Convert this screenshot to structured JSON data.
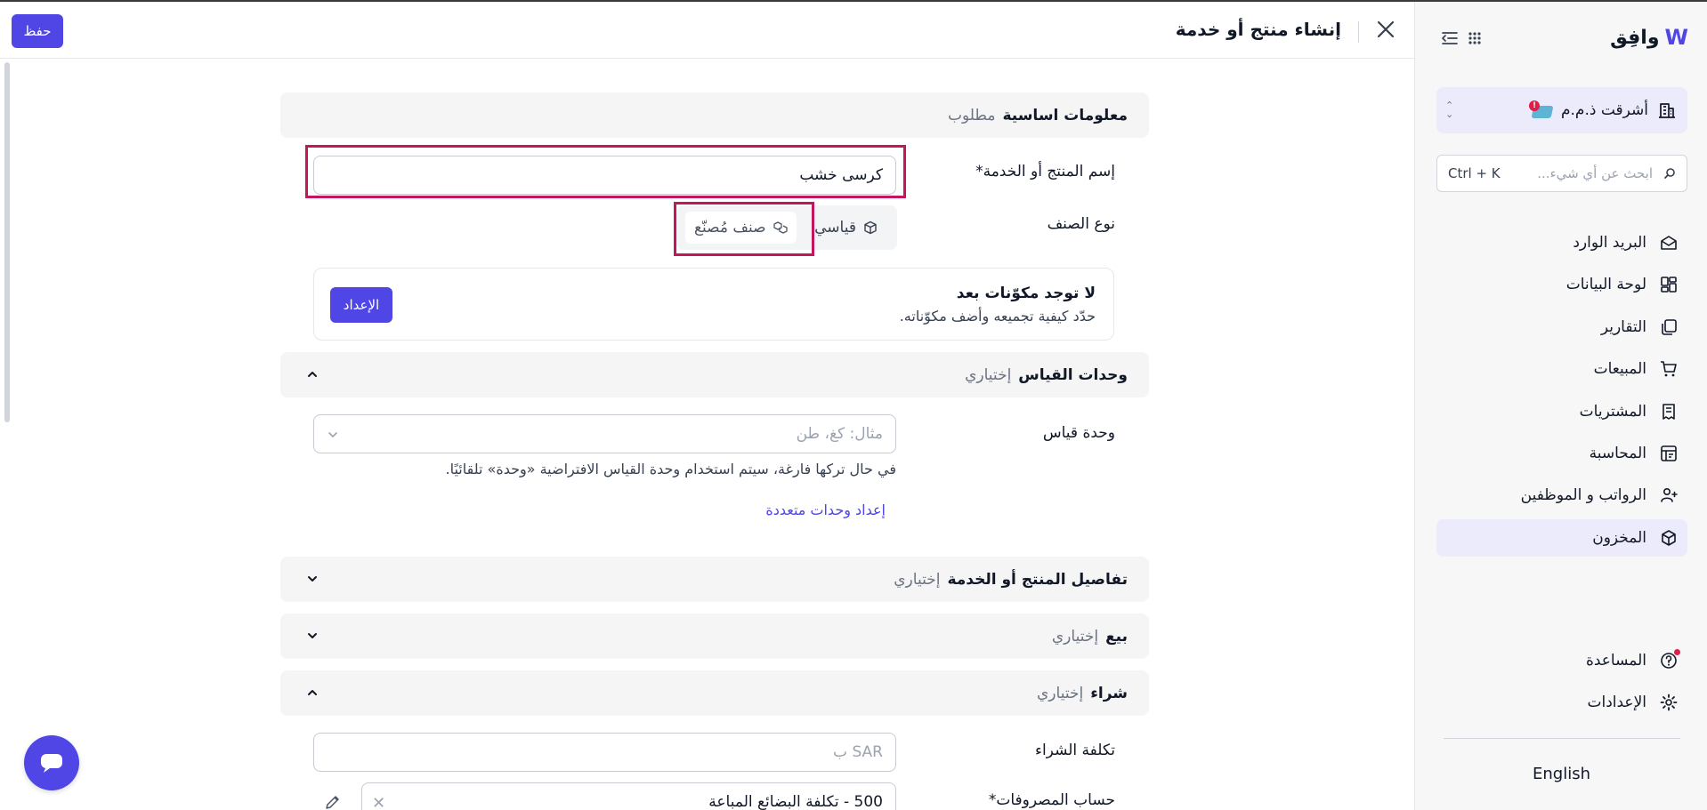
{
  "app": {
    "brand": "وافِق"
  },
  "header": {
    "title": "إنشاء منتج أو خدمة",
    "save_label": "حفظ"
  },
  "sidebar": {
    "company_name": "أشرقت ذ.م.م",
    "search_placeholder": "ابحث عن أي شيء...",
    "search_shortcut": "Ctrl + K",
    "items": [
      {
        "label": "البريد الوارد",
        "icon": "inbox-icon"
      },
      {
        "label": "لوحة البيانات",
        "icon": "dashboard-icon"
      },
      {
        "label": "التقارير",
        "icon": "reports-icon"
      },
      {
        "label": "المبيعات",
        "icon": "cart-icon"
      },
      {
        "label": "المشتريات",
        "icon": "receipt-icon"
      },
      {
        "label": "المحاسبة",
        "icon": "ledger-icon"
      },
      {
        "label": "الرواتب و الموظفين",
        "icon": "users-icon"
      },
      {
        "label": "المخزون",
        "icon": "box-icon",
        "active": true
      }
    ],
    "help_label": "المساعدة",
    "settings_label": "الإعدادات",
    "language": "English"
  },
  "form": {
    "basic": {
      "title": "معلومات اساسية",
      "sub": "مطلوب"
    },
    "name_label": "إسم المنتج أو الخدمة*",
    "name_value": "كرسى خشب",
    "type_label": "نوع الصنف",
    "type_standard": "قياسي",
    "type_manufactured": "صنف مُصنّع",
    "components": {
      "title": "لا توجد مكوّنات بعد",
      "desc": "حدّد كيفية تجميعه وأضف مكوّناته.",
      "button": "الإعداد"
    },
    "units": {
      "title": "وحدات القياس",
      "sub": "إختياري",
      "unit_label": "وحدة قياس",
      "unit_placeholder": "مثال: كغ، طن",
      "hint": "في حال تركها فارغة، سيتم استخدام وحدة القياس الافتراضية «وحدة» تلقائيًا.",
      "multi_link": "إعداد وحدات متعددة"
    },
    "details": {
      "title": "تفاصيل المنتج أو الخدمة",
      "sub": "إختياري"
    },
    "sell": {
      "title": "بيع",
      "sub": "إختياري"
    },
    "purchase": {
      "title": "شراء",
      "sub": "إختياري",
      "cost_label": "تكلفة الشراء",
      "cost_placeholder": "SAR ب",
      "expense_label": "حساب المصروفات*",
      "expense_value": "500 - تكلفة البضائع المباعة"
    }
  },
  "colors": {
    "accent": "#4f46e5",
    "highlight": "#c2185b",
    "active_bg": "#ebebfb"
  }
}
